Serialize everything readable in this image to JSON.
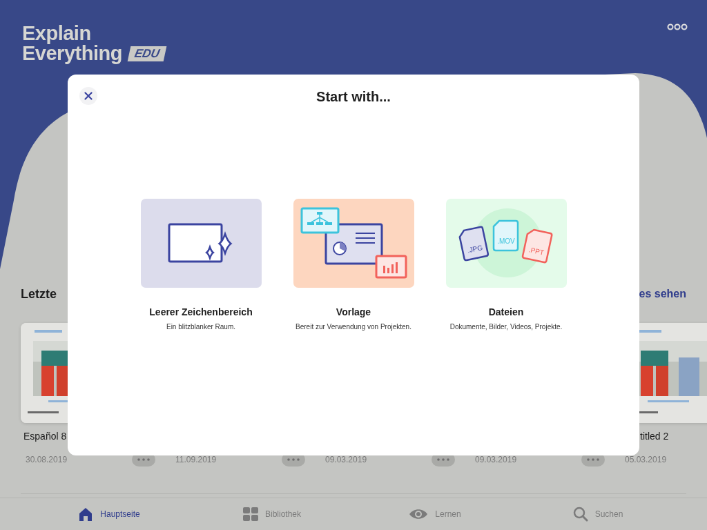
{
  "header": {
    "logo": {
      "line_1": "Explain",
      "line_2": "Everything",
      "badge": "EDU"
    }
  },
  "recent": {
    "title": "Letzte",
    "see_all": "es sehen",
    "projects": [
      {
        "title": "Español 8",
        "date": "30.08.2019"
      },
      {
        "date": "11.09.2019"
      },
      {
        "date": "09.03.2019"
      },
      {
        "date": "09.03.2019"
      },
      {
        "title": "titled 2",
        "date": "05.03.2019"
      }
    ]
  },
  "dialog": {
    "title": "Start with...",
    "options": [
      {
        "kind": "blank",
        "title": "Leerer Zeichenbereich",
        "subtitle": "Ein blitzblanker Raum."
      },
      {
        "kind": "template",
        "title": "Vorlage",
        "subtitle": "Bereit zur Verwendung von Projekten."
      },
      {
        "kind": "files",
        "title": "Dateien",
        "subtitle": "Dokumente, Bilder, Videos, Projekte.",
        "file_types": [
          ".JPG",
          ".MOV",
          ".PPT"
        ]
      }
    ]
  },
  "tab_bar": [
    {
      "kind": "home",
      "label": "Hauptseite",
      "selected": true
    },
    {
      "kind": "library",
      "label": "Bibliothek",
      "selected": false
    },
    {
      "kind": "learn",
      "label": "Lernen",
      "selected": false
    },
    {
      "kind": "search",
      "label": "Suchen",
      "selected": false
    }
  ]
}
